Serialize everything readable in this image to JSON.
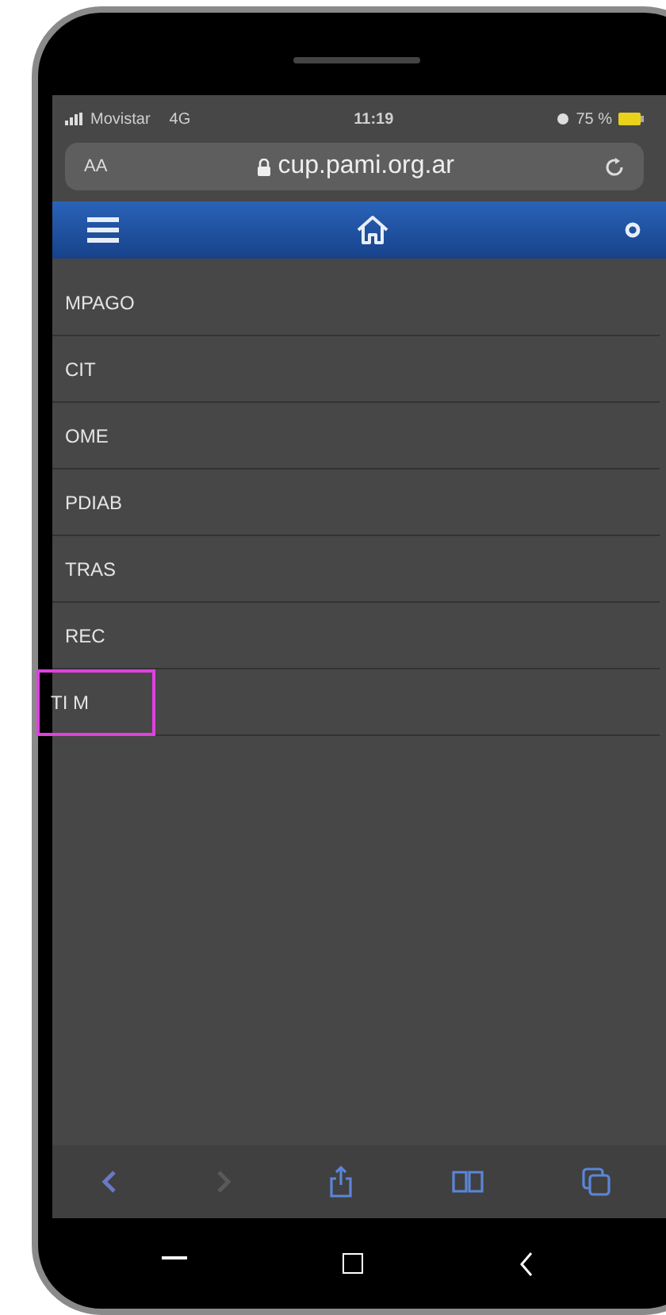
{
  "status_bar": {
    "carrier": "Movistar",
    "network": "4G",
    "time": "11:19",
    "battery": "75 %"
  },
  "address_bar": {
    "text_size": "AA",
    "url": "cup.pami.org.ar"
  },
  "menu_items": [
    {
      "label": "MPAGO",
      "highlighted": false
    },
    {
      "label": "CIT",
      "highlighted": false
    },
    {
      "label": "OME",
      "highlighted": false
    },
    {
      "label": "PDIAB",
      "highlighted": false
    },
    {
      "label": "TRAS",
      "highlighted": false
    },
    {
      "label": "REC",
      "highlighted": false
    },
    {
      "label": "TI M",
      "highlighted": true
    }
  ]
}
